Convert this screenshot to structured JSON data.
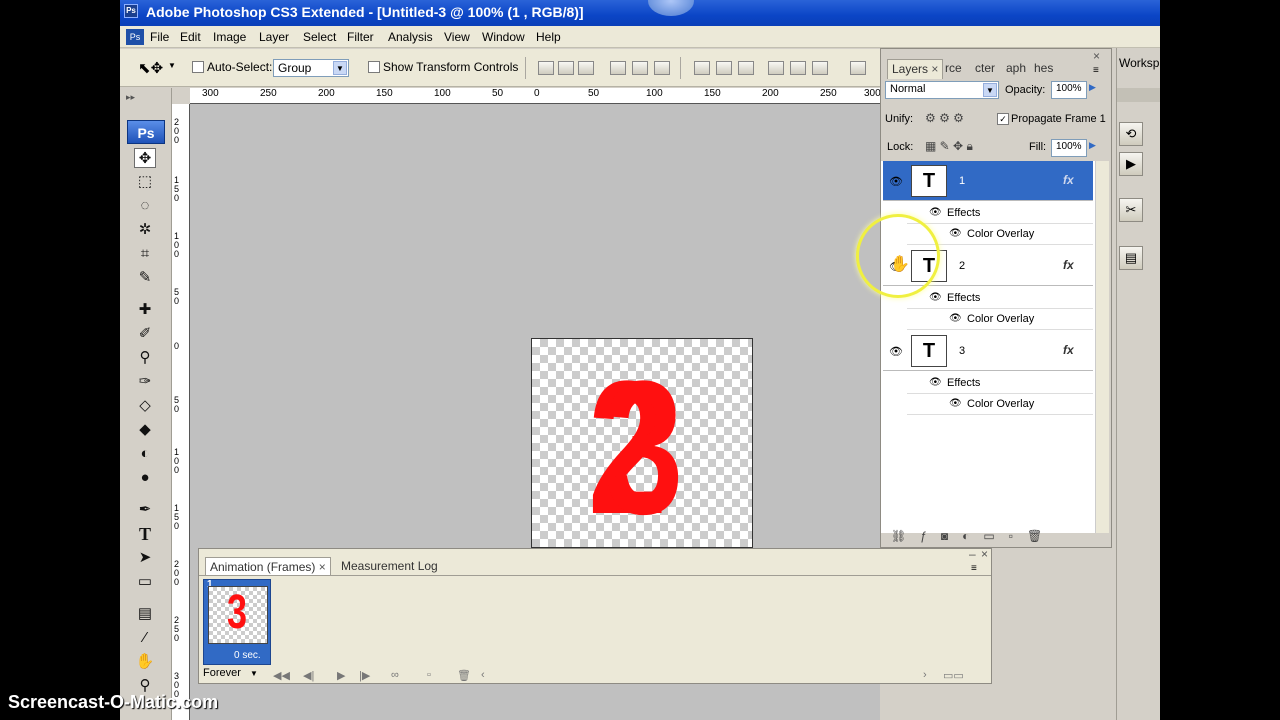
{
  "window": {
    "title": "Adobe Photoshop CS3 Extended - [Untitled-3 @ 100% (1 , RGB/8)]",
    "ps_badge": "Ps"
  },
  "menu": [
    "File",
    "Edit",
    "Image",
    "Layer",
    "Select",
    "Filter",
    "Analysis",
    "View",
    "Window",
    "Help"
  ],
  "options": {
    "auto_select_label": "Auto-Select:",
    "auto_select_value": "Group",
    "show_transform_label": "Show Transform Controls"
  },
  "workspace_label": "Worksp",
  "ruler": {
    "top": [
      "300",
      "250",
      "200",
      "150",
      "100",
      "50",
      "0",
      "50",
      "100",
      "150",
      "200",
      "250",
      "300"
    ],
    "left": [
      "2 0 0",
      "1 5 0",
      "1 0 0",
      "5 0",
      "0",
      "5 0",
      "1 0 0",
      "1 5 0",
      "2 0 0",
      "2 5 0",
      "3 0 0"
    ]
  },
  "document": {
    "glyph_front": "3",
    "glyph_back": "2"
  },
  "layers_panel": {
    "tabs": [
      "Layers",
      "rce",
      "cter",
      "aph",
      "hes"
    ],
    "blend_mode": "Normal",
    "opacity_label": "Opacity:",
    "opacity_value": "100%",
    "unify_label": "Unify:",
    "propagate_label": "Propagate Frame 1",
    "lock_label": "Lock:",
    "fill_label": "Fill:",
    "fill_value": "100%",
    "layers": [
      {
        "name": "1",
        "thumb": "T",
        "fx": "fx",
        "effects": "Effects",
        "overlay": "Color Overlay",
        "selected": true
      },
      {
        "name": "2",
        "thumb": "T",
        "fx": "fx",
        "effects": "Effects",
        "overlay": "Color Overlay",
        "selected": false
      },
      {
        "name": "3",
        "thumb": "T",
        "fx": "fx",
        "effects": "Effects",
        "overlay": "Color Overlay",
        "selected": false
      }
    ]
  },
  "animation_panel": {
    "tabs": [
      "Animation (Frames)",
      "Measurement Log"
    ],
    "frame_number": "1",
    "frame_glyph": "3",
    "frame_delay": "0 sec.",
    "loop": "Forever"
  },
  "watermark": "Screencast-O-Matic.com",
  "colors": {
    "accent": "#316ac5",
    "title_bar": "#0b45c6",
    "glyph": "#ff1010"
  }
}
